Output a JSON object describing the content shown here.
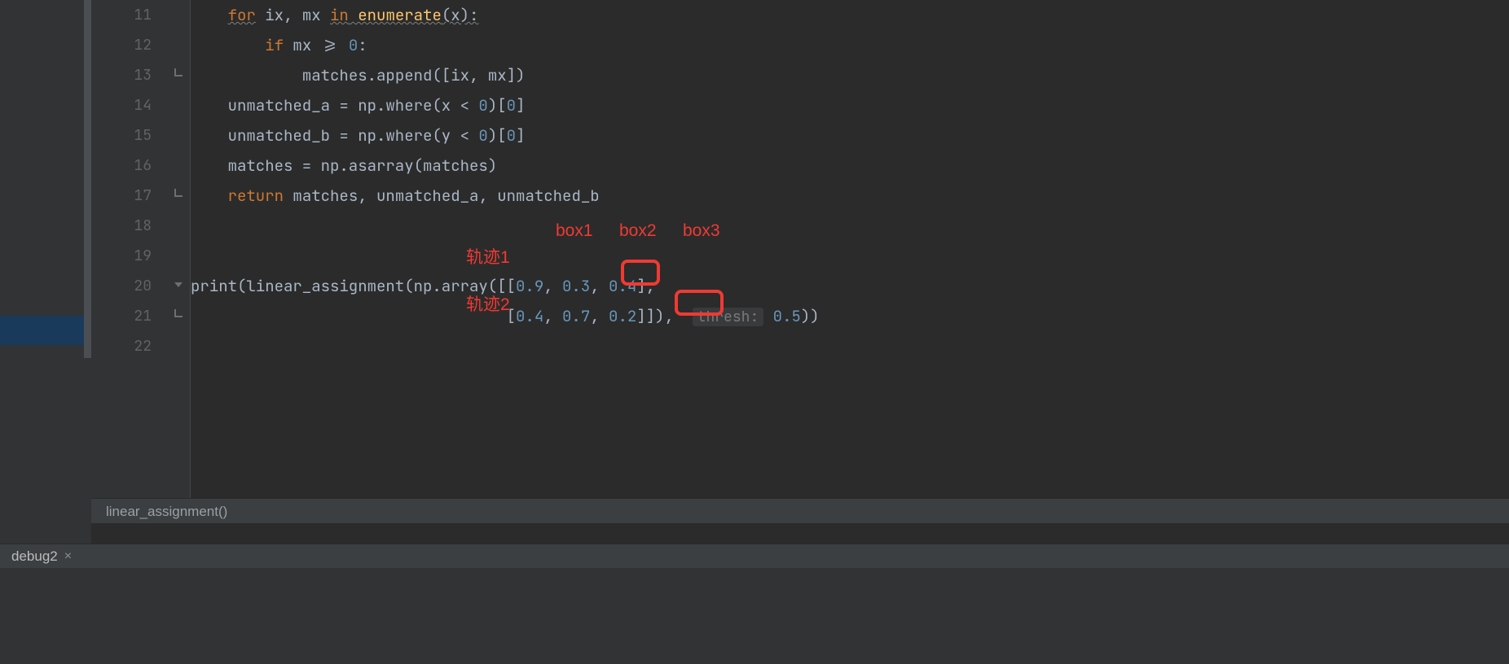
{
  "gutter": {
    "numbers": [
      "11",
      "12",
      "13",
      "14",
      "15",
      "16",
      "17",
      "18",
      "19",
      "20",
      "21",
      "22"
    ]
  },
  "fold": {
    "marks": [
      "",
      "",
      "end",
      "",
      "",
      "",
      "end",
      "",
      "",
      "open",
      "end",
      ""
    ]
  },
  "code": {
    "l11_for": "for",
    "l11_ix": " ix",
    "l11_comma1": ", ",
    "l11_mx": "mx ",
    "l11_in": "in",
    "l11_enum": " enumerate",
    "l11_tail": "(x):",
    "l12_if": "if",
    "l12_cond_a": " mx >= ",
    "l12_zero": "0",
    "l12_cond_b": ":",
    "l13_a": "matches.append([ix",
    "l13_b": ", ",
    "l13_c": "mx])",
    "l14_a": "unmatched_a = np.where(x < ",
    "l14_zero": "0",
    "l14_b": ")[",
    "l14_zero2": "0",
    "l14_c": "]",
    "l15_a": "unmatched_b = np.where(y < ",
    "l15_zero": "0",
    "l15_b": ")[",
    "l15_zero2": "0",
    "l15_c": "]",
    "l16_a": "matches = np.asarray(matches)",
    "l17_ret": "return",
    "l17_rest": " matches",
    "l17_b": ", ",
    "l17_c": "unmatched_a",
    "l17_d": ", ",
    "l17_e": "unmatched_b",
    "l20_a": "print(linear_assignment(np.array([[",
    "l20_n1": "0.9",
    "l20_s1": ", ",
    "l20_n2": "0.3",
    "l20_s2": ", ",
    "l20_n3": "0.4",
    "l20_b": "],",
    "l21_pad": "                                  [",
    "l21_n1": "0.4",
    "l21_s1": ", ",
    "l21_n2": "0.7",
    "l21_s2": ", ",
    "l21_n3": "0.2",
    "l21_b": "]]),  ",
    "l21_hint": "thresh:",
    "l21_sp": " ",
    "l21_n4": "0.5",
    "l21_c": "))"
  },
  "annotations": {
    "box1": "box1",
    "box2": "box2",
    "box3": "box3",
    "track1": "轨迹1",
    "track2": "轨迹2"
  },
  "breadcrumb": {
    "text": "linear_assignment()"
  },
  "tabbar": {
    "tab1": "debug2",
    "close": "×"
  }
}
